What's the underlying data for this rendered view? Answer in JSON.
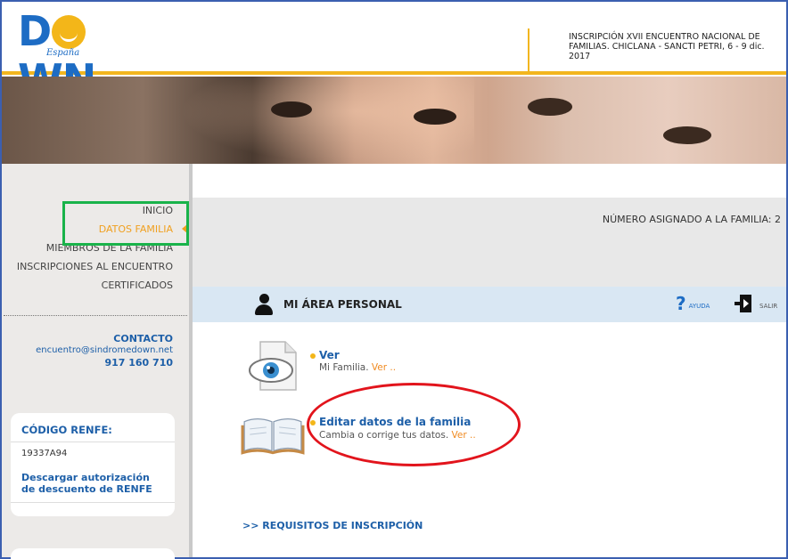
{
  "header": {
    "logo_text": "DOWN",
    "logo_subtext": "España",
    "title": "INSCRIPCIÓN XVII ENCUENTRO NACIONAL DE FAMILIAS. CHICLANA - SANCTI PETRI, 6 - 9 dic. 2017"
  },
  "sidebar": {
    "nav": [
      {
        "label": "INICIO",
        "active": false
      },
      {
        "label": "DATOS FAMILIA",
        "active": true
      },
      {
        "label": "MIEMBROS DE LA FAMILIA",
        "active": false
      },
      {
        "label": "INSCRIPCIONES AL ENCUENTRO",
        "active": false
      },
      {
        "label": "CERTIFICADOS",
        "active": false
      }
    ],
    "contact": {
      "title": "CONTACTO",
      "email": "encuentro@sindromedown.net",
      "phone": "917 160 710"
    },
    "renfe": {
      "title": "CÓDIGO RENFE:",
      "code": "19337A94",
      "link": "Descargar autorización de descuento de RENFE"
    }
  },
  "main": {
    "family_number": "NÚMERO ASIGNADO A LA FAMILIA: 2",
    "area_title": "MI ÁREA PERSONAL",
    "help_label": "AYUDA",
    "logout_label": "SALIR",
    "items": [
      {
        "title": "Ver",
        "desc": "Mi Familia.",
        "more": "Ver .."
      },
      {
        "title": "Editar datos de la familia",
        "desc": "Cambia o corrige tus datos.",
        "more": "Ver .."
      }
    ],
    "requisitos": ">> REQUISITOS DE INSCRIPCIÓN"
  },
  "colors": {
    "accent_blue": "#1d5fa8",
    "accent_yellow": "#f3b619",
    "active_orange": "#f0a020",
    "annotation_green": "#19b34a",
    "annotation_red": "#e2141c"
  }
}
